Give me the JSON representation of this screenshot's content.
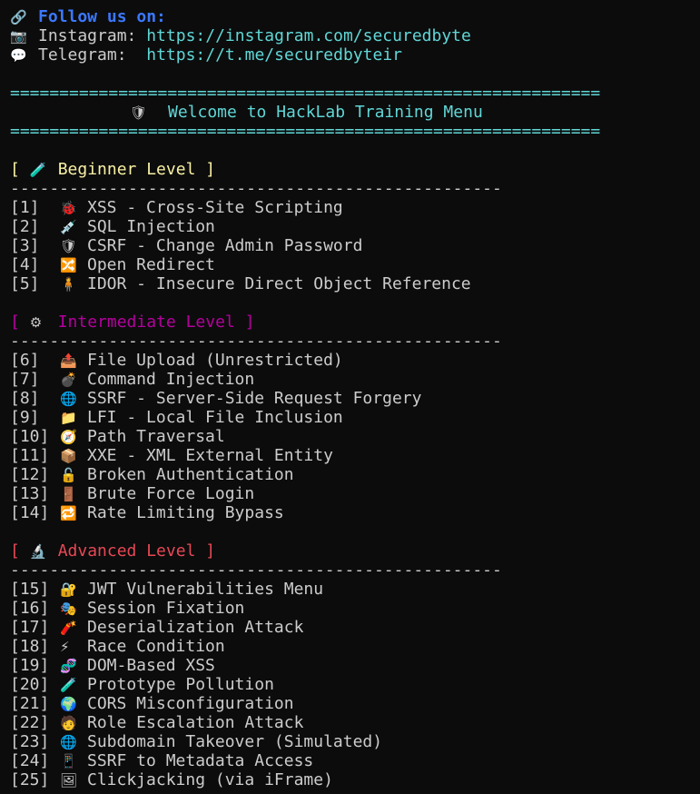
{
  "follow": {
    "icon": "🔗",
    "heading": "Follow us on:",
    "instagram_icon": "📷",
    "instagram_label": "Instagram:",
    "instagram_url": "https://instagram.com/securedbyte",
    "telegram_icon": "💬",
    "telegram_label": "Telegram:",
    "telegram_url": "https://t.me/securedbyteir"
  },
  "banner": {
    "rule": "============================================================",
    "icon": "🛡",
    "title": "Welcome to HackLab Training Menu"
  },
  "separator": "--------------------------------------------------",
  "sections": {
    "beginner": {
      "open": "[",
      "icon": "🧪",
      "label": "Beginner Level",
      "close": "]",
      "items": [
        {
          "num": "[1]",
          "icon": "🐞",
          "text": "XSS - Cross-Site Scripting"
        },
        {
          "num": "[2]",
          "icon": "💉",
          "text": "SQL Injection"
        },
        {
          "num": "[3]",
          "icon": "🛡",
          "text": "CSRF - Change Admin Password"
        },
        {
          "num": "[4]",
          "icon": "🔀",
          "text": "Open Redirect"
        },
        {
          "num": "[5]",
          "icon": "🧍",
          "text": "IDOR - Insecure Direct Object Reference"
        }
      ]
    },
    "intermediate": {
      "open": "[",
      "icon": "⚙",
      "label": "Intermediate Level",
      "close": "]",
      "items": [
        {
          "num": "[6]",
          "icon": "📤",
          "text": "File Upload (Unrestricted)"
        },
        {
          "num": "[7]",
          "icon": "💣",
          "text": "Command Injection"
        },
        {
          "num": "[8]",
          "icon": "🌐",
          "text": "SSRF - Server-Side Request Forgery"
        },
        {
          "num": "[9]",
          "icon": "📁",
          "text": "LFI - Local File Inclusion"
        },
        {
          "num": "[10]",
          "icon": "🧭",
          "text": "Path Traversal"
        },
        {
          "num": "[11]",
          "icon": "📦",
          "text": "XXE - XML External Entity"
        },
        {
          "num": "[12]",
          "icon": "🔓",
          "text": "Broken Authentication"
        },
        {
          "num": "[13]",
          "icon": "🚪",
          "text": "Brute Force Login"
        },
        {
          "num": "[14]",
          "icon": "🔁",
          "text": "Rate Limiting Bypass"
        }
      ]
    },
    "advanced": {
      "open": "[",
      "icon": "🔬",
      "label": "Advanced Level",
      "close": "]",
      "items": [
        {
          "num": "[15]",
          "icon": "🔐",
          "text": "JWT Vulnerabilities Menu"
        },
        {
          "num": "[16]",
          "icon": "🎭",
          "text": "Session Fixation"
        },
        {
          "num": "[17]",
          "icon": "🧨",
          "text": "Deserialization Attack"
        },
        {
          "num": "[18]",
          "icon": "⚡",
          "text": "Race Condition"
        },
        {
          "num": "[19]",
          "icon": "🧬",
          "text": "DOM-Based XSS"
        },
        {
          "num": "[20]",
          "icon": "🧪",
          "text": "Prototype Pollution"
        },
        {
          "num": "[21]",
          "icon": "🌍",
          "text": "CORS Misconfiguration"
        },
        {
          "num": "[22]",
          "icon": "🧑",
          "text": "Role Escalation Attack"
        },
        {
          "num": "[23]",
          "icon": "🌐",
          "text": "Subdomain Takeover (Simulated)"
        },
        {
          "num": "[24]",
          "icon": "📱",
          "text": "SSRF to Metadata Access"
        },
        {
          "num": "[25]",
          "icon": "🖼",
          "text": "Clickjacking (via iFrame)"
        }
      ]
    }
  },
  "colors": {
    "background": "#0c0c0c",
    "text": "#cccccc",
    "heading_blue": "#3b78ff",
    "cyan": "#61d6d6",
    "beginner_yellow": "#f9f1a5",
    "intermediate_magenta": "#b4009e",
    "advanced_red": "#e74856"
  }
}
